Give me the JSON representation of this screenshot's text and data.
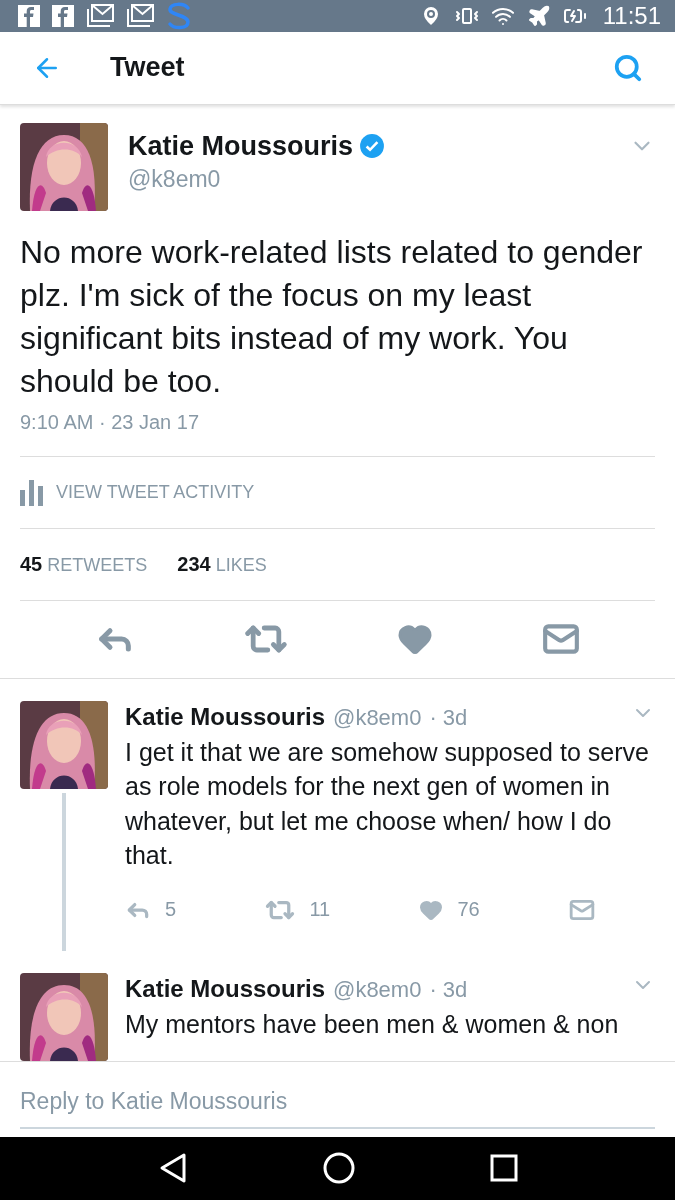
{
  "status_bar": {
    "time": "11:51"
  },
  "app_bar": {
    "title": "Tweet"
  },
  "tweet": {
    "name": "Katie Moussouris",
    "verified": true,
    "handle": "@k8em0",
    "text": "No more work-related lists related to gender plz. I'm sick of the focus on my least significant bits instead of my work. You should be too.",
    "timestamp": "9:10 AM · 23 Jan 17",
    "activity_link": "VIEW TWEET ACTIVITY",
    "stats": [
      {
        "count": "45",
        "label": "RETWEETS"
      },
      {
        "count": "234",
        "label": "LIKES"
      }
    ]
  },
  "replies": [
    {
      "name": "Katie Moussouris",
      "handle": "@k8em0",
      "age": "· 3d",
      "text": "I get it that we are somehow supposed to serve as role models for the next gen of women in whatever, but let me choose when/ how I do that.",
      "threaded": true,
      "reply_count": "5",
      "retweet_count": "11",
      "like_count": "76"
    },
    {
      "name": "Katie Moussouris",
      "handle": "@k8em0",
      "age": "· 3d",
      "text": "My mentors have been men & women & non",
      "threaded": false
    }
  ],
  "reply_field": {
    "placeholder": "Reply to Katie Moussouris"
  }
}
